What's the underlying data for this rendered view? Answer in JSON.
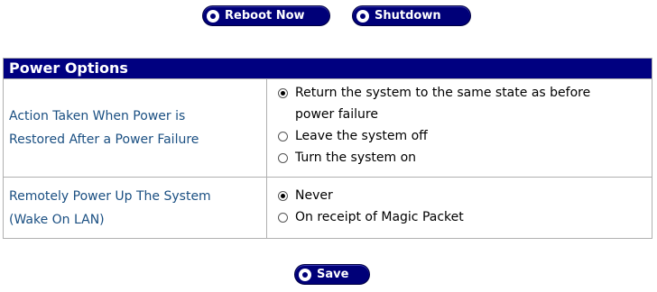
{
  "toolbar": {
    "reboot_label": "Reboot Now",
    "shutdown_label": "Shutdown"
  },
  "panel": {
    "title": "Power Options",
    "sections": [
      {
        "label_lines": [
          "Action Taken When Power is",
          "Restored After a Power Failure"
        ],
        "options": [
          {
            "lines": [
              "Return the system to the same state as before",
              "power failure"
            ],
            "selected": true
          },
          {
            "lines": [
              "Leave the system off"
            ],
            "selected": false
          },
          {
            "lines": [
              "Turn the system on"
            ],
            "selected": false
          }
        ]
      },
      {
        "label_lines": [
          "Remotely Power Up The System",
          "(Wake On LAN)"
        ],
        "options": [
          {
            "lines": [
              "Never"
            ],
            "selected": true
          },
          {
            "lines": [
              "On receipt of Magic Packet"
            ],
            "selected": false
          }
        ]
      }
    ]
  },
  "footer": {
    "save_label": "Save"
  },
  "colors": {
    "accent": "#000080",
    "label_text": "#1a4f82",
    "border": "#b0b0b0"
  }
}
